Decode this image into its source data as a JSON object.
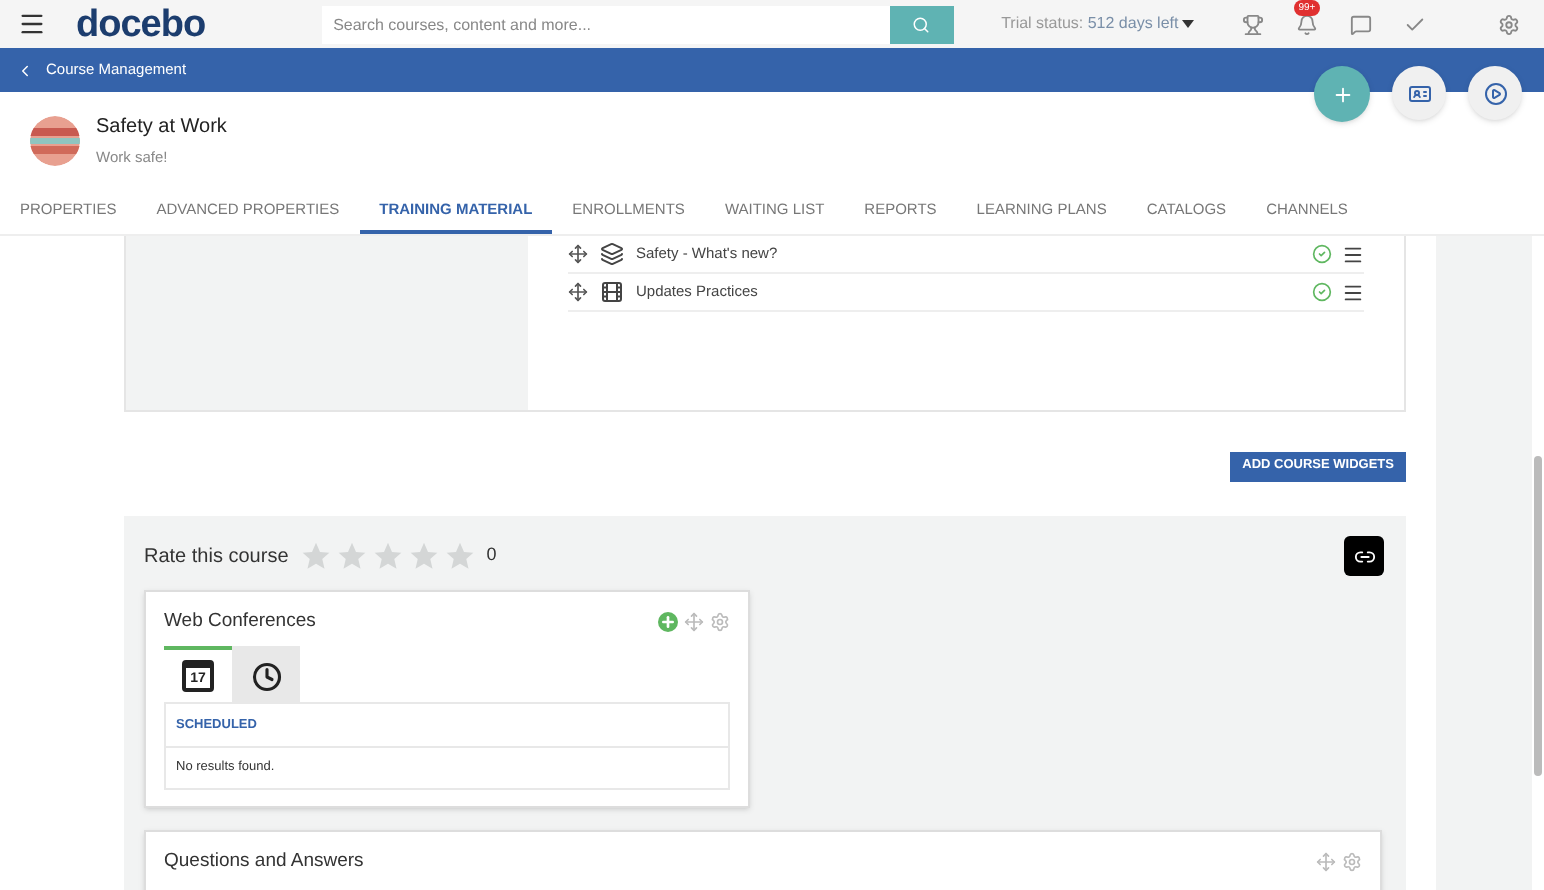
{
  "topbar": {
    "logo": "docebo",
    "search": {
      "placeholder": "Search courses, content and more..."
    },
    "trial_label": "Trial status:",
    "trial_value": "512 days left",
    "notification_badge": "99+"
  },
  "breadcrumb": {
    "label": "Course Management"
  },
  "course": {
    "title": "Safety at Work",
    "subtitle": "Work safe!"
  },
  "tabs": [
    {
      "label": "PROPERTIES",
      "selected": false
    },
    {
      "label": "ADVANCED PROPERTIES",
      "selected": false
    },
    {
      "label": "TRAINING MATERIAL",
      "selected": true
    },
    {
      "label": "ENROLLMENTS",
      "selected": false
    },
    {
      "label": "WAITING LIST",
      "selected": false
    },
    {
      "label": "REPORTS",
      "selected": false
    },
    {
      "label": "LEARNING PLANS",
      "selected": false
    },
    {
      "label": "CATALOGS",
      "selected": false
    },
    {
      "label": "CHANNELS",
      "selected": false
    }
  ],
  "training_material": [
    {
      "title": "Safety - What's new?",
      "kind": "layers",
      "completed": true
    },
    {
      "title": "Updates Practices",
      "kind": "video",
      "completed": true
    }
  ],
  "add_widgets_button": "ADD COURSE WIDGETS",
  "rating": {
    "label": "Rate this course",
    "stars": 0,
    "count": "0"
  },
  "web_conferences": {
    "title": "Web Conferences",
    "tabs": [
      {
        "kind": "calendar",
        "day": "17",
        "selected": true
      },
      {
        "kind": "clock",
        "selected": false
      }
    ],
    "column": "SCHEDULED",
    "empty": "No results found."
  },
  "questions": {
    "title": "Questions and Answers"
  }
}
